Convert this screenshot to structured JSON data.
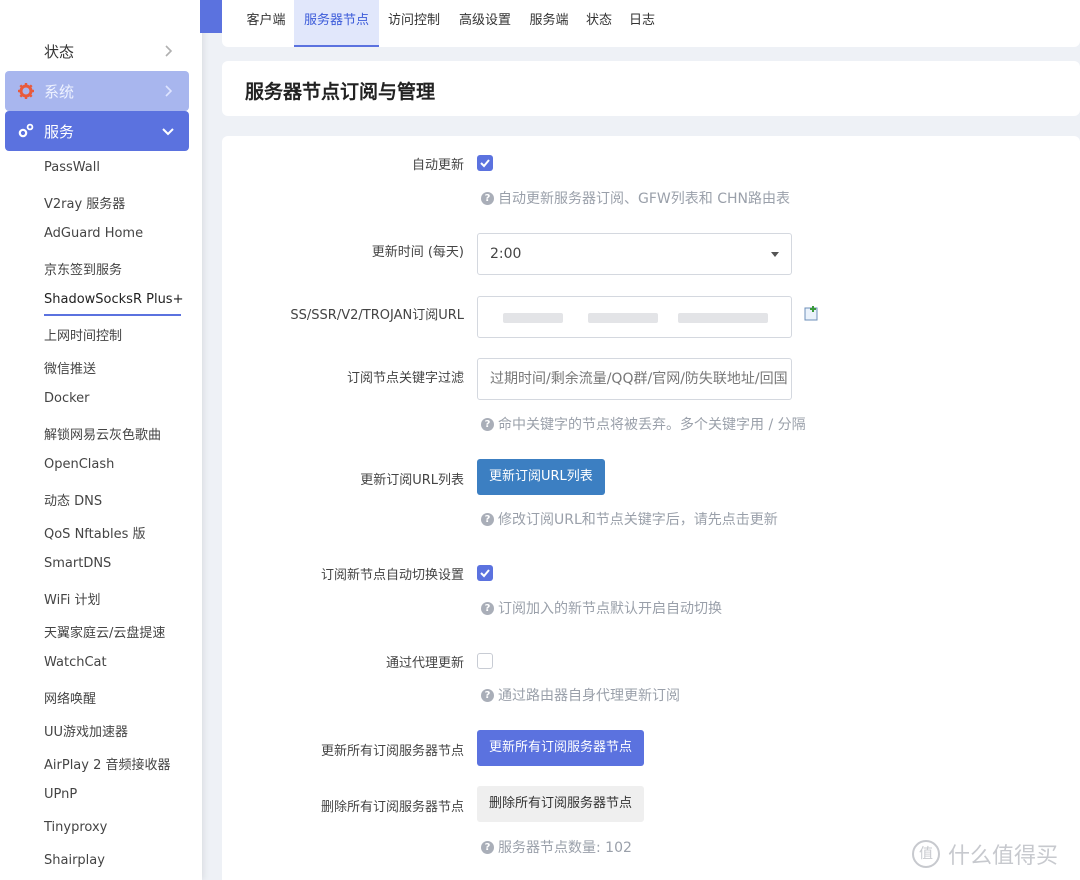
{
  "sidebar": {
    "top_menu": [
      {
        "label": "状态"
      },
      {
        "label": "系统"
      },
      {
        "label": "服务"
      }
    ],
    "sub_items": [
      "PassWall",
      "V2ray 服务器",
      "AdGuard Home",
      "京东签到服务",
      "ShadowSocksR Plus+",
      "上网时间控制",
      "微信推送",
      "Docker",
      "解锁网易云灰色歌曲",
      "OpenClash",
      "动态 DNS",
      "QoS Nftables 版",
      "SmartDNS",
      "WiFi 计划",
      "天翼家庭云/云盘提速",
      "WatchCat",
      "网络唤醒",
      "UU游戏加速器",
      "AirPlay 2 音频接收器",
      "UPnP",
      "Tinyproxy",
      "Shairplay"
    ]
  },
  "tabs": [
    "客户端",
    "服务器节点",
    "访问控制",
    "高级设置",
    "服务端",
    "状态",
    "日志"
  ],
  "page_title": "服务器节点订阅与管理",
  "form": {
    "auto_update": {
      "label": "自动更新",
      "checked": true,
      "help": "自动更新服务器订阅、GFW列表和 CHN路由表"
    },
    "update_time": {
      "label": "更新时间 (每天)",
      "value": "2:00"
    },
    "sub_url": {
      "label": "SS/SSR/V2/TROJAN订阅URL"
    },
    "keyword_filter": {
      "label": "订阅节点关键字过滤",
      "value": "过期时间/剩余流量/QQ群/官网/防失联地址/回国",
      "help": "命中关键字的节点将被丢弃。多个关键字用 / 分隔"
    },
    "update_url_list": {
      "label": "更新订阅URL列表",
      "button": "更新订阅URL列表",
      "help": "修改订阅URL和节点关键字后，请先点击更新"
    },
    "auto_switch": {
      "label": "订阅新节点自动切换设置",
      "checked": true,
      "help": "订阅加入的新节点默认开启自动切换"
    },
    "proxy_update": {
      "label": "通过代理更新",
      "checked": false,
      "help": "通过路由器自身代理更新订阅"
    },
    "update_all": {
      "label": "更新所有订阅服务器节点",
      "button": "更新所有订阅服务器节点"
    },
    "delete_all": {
      "label": "删除所有订阅服务器节点",
      "button": "删除所有订阅服务器节点",
      "help": "服务器节点数量: 102"
    }
  },
  "watermark": {
    "text": "什么值得买",
    "logo": "值"
  },
  "colors": {
    "accent": "#5b72df",
    "button_blue": "#3c7fc2",
    "help_text": "#9aa0aa"
  }
}
